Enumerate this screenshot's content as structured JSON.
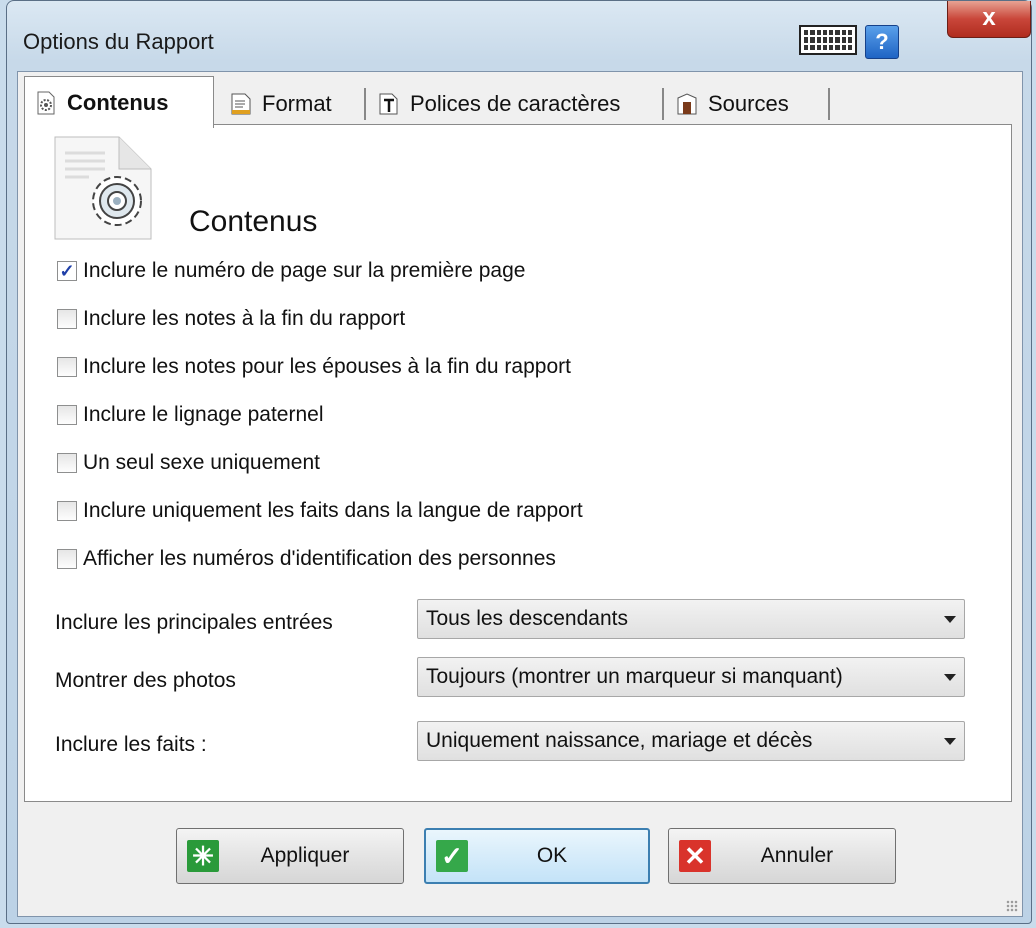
{
  "window": {
    "title": "Options du Rapport",
    "close_label": "x",
    "help_label": "?"
  },
  "tabs": [
    {
      "label": "Contenus",
      "icon": "gear-doc-icon",
      "active": true
    },
    {
      "label": "Format",
      "icon": "format-icon",
      "active": false
    },
    {
      "label": "Polices de caractères",
      "icon": "font-icon",
      "active": false
    },
    {
      "label": "Sources",
      "icon": "sources-icon",
      "active": false
    }
  ],
  "panel": {
    "heading": "Contenus",
    "checkboxes": [
      {
        "label": "Inclure le numéro de page sur la première page",
        "checked": true
      },
      {
        "label": "Inclure les notes à la fin du rapport",
        "checked": false
      },
      {
        "label": "Inclure les notes pour les épouses à la fin du rapport",
        "checked": false
      },
      {
        "label": "Inclure le lignage paternel",
        "checked": false
      },
      {
        "label": "Un seul sexe uniquement",
        "checked": false
      },
      {
        "label": "Inclure uniquement les faits dans la langue de rapport",
        "checked": false
      },
      {
        "label": "Afficher les numéros d'identification des personnes",
        "checked": false
      }
    ],
    "fields": [
      {
        "label": "Inclure les principales entrées",
        "value": "Tous les descendants"
      },
      {
        "label": "Montrer des photos",
        "value": "Toujours (montrer un marqueur si manquant)"
      },
      {
        "label": "Inclure les faits :",
        "value": "Uniquement naissance, mariage et décès"
      }
    ]
  },
  "buttons": {
    "apply": "Appliquer",
    "ok": "OK",
    "cancel": "Annuler"
  },
  "colors": {
    "apply_icon": "#2a9a3a",
    "ok_icon": "#35a84a",
    "cancel_icon": "#d9332b",
    "check": "#1f3fa8"
  }
}
